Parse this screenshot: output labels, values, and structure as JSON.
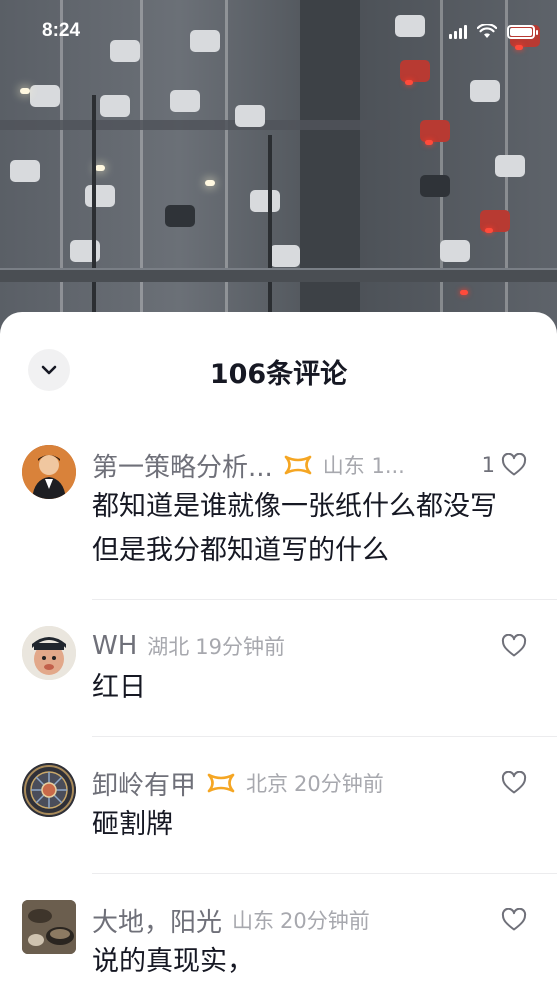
{
  "status_bar": {
    "time": "8:24"
  },
  "sheet": {
    "title": "106条评论"
  },
  "comments": [
    {
      "username": "第一策略分析...",
      "has_badge": true,
      "location": "山东 1...",
      "time": "",
      "like_count": "1",
      "text": "都知道是谁就像一张纸什么都没写但是我分都知道写的什么"
    },
    {
      "username": "WH",
      "has_badge": false,
      "location": "湖北",
      "time": "19分钟前",
      "like_count": "",
      "text": "红日"
    },
    {
      "username": "卸岭有甲",
      "has_badge": true,
      "location": "北京",
      "time": "20分钟前",
      "like_count": "",
      "text": "砸割牌"
    },
    {
      "username": "大地，阳光",
      "has_badge": false,
      "location": "山东",
      "time": "20分钟前",
      "like_count": "",
      "text": "说的真现实，"
    }
  ],
  "colors": {
    "badge": "#f5a623",
    "text_primary": "#161823",
    "text_secondary": "#6f7079",
    "text_tertiary": "#a7a8ae"
  },
  "icons": [
    "chevron-down-icon",
    "heart-outline-icon",
    "fan-badge-icon",
    "wifi-icon",
    "signal-icon",
    "battery-icon"
  ]
}
